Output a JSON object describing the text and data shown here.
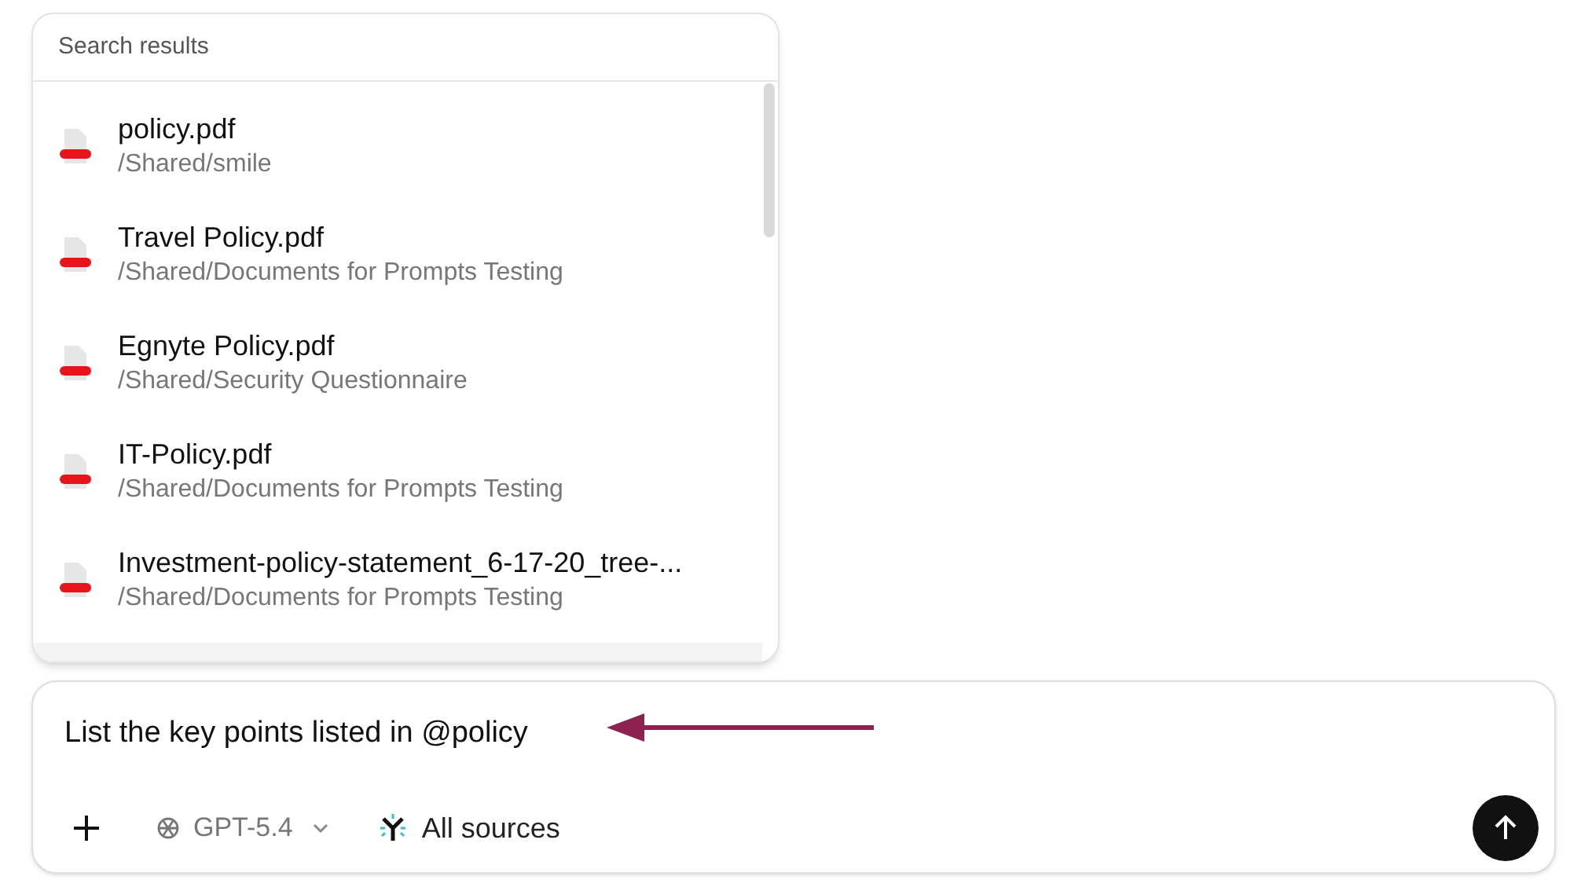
{
  "search_results": {
    "title": "Search results",
    "items": [
      {
        "name": "policy.pdf",
        "path": "/Shared/smile"
      },
      {
        "name": "Travel Policy.pdf",
        "path": "/Shared/Documents for Prompts Testing"
      },
      {
        "name": "Egnyte Policy.pdf",
        "path": "/Shared/Security Questionnaire"
      },
      {
        "name": "IT-Policy.pdf",
        "path": "/Shared/Documents for Prompts Testing"
      },
      {
        "name": "Investment-policy-statement_6-17-20_tree-...",
        "path": "/Shared/Documents for Prompts Testing"
      }
    ]
  },
  "composer": {
    "value": "List the key points listed in @policy",
    "model": "GPT-5.4",
    "sources": "All sources"
  }
}
